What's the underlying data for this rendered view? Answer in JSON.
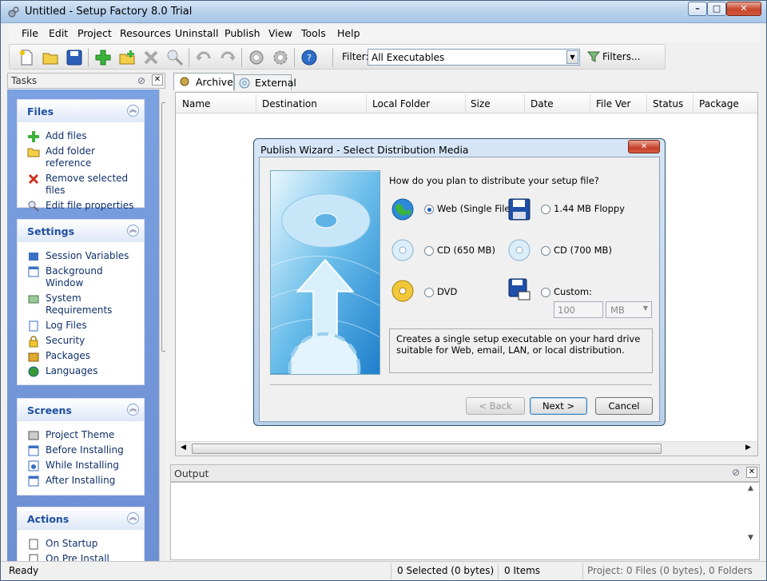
{
  "window": {
    "title": "Untitled - Setup Factory 8.0 Trial",
    "min": "–",
    "max": "□",
    "close": "✕"
  },
  "menu": [
    "File",
    "Edit",
    "Project",
    "Resources",
    "Uninstall",
    "Publish",
    "View",
    "Tools",
    "Help"
  ],
  "toolbar": {
    "filter_label": "Filter:",
    "filter_value": "All Executables",
    "filters_button": "Filters..."
  },
  "tasks": {
    "title": "Tasks",
    "groups": [
      {
        "title": "Files",
        "items": [
          "Add files",
          "Add folder reference",
          "Remove selected files",
          "Edit file properties"
        ]
      },
      {
        "title": "Settings",
        "items": [
          "Session Variables",
          "Background Window",
          "System Requirements",
          "Log Files",
          "Security",
          "Packages",
          "Languages"
        ]
      },
      {
        "title": "Screens",
        "items": [
          "Project Theme",
          "Before Installing",
          "While Installing",
          "After Installing"
        ]
      },
      {
        "title": "Actions",
        "items": [
          "On Startup",
          "On Pre Install"
        ]
      }
    ]
  },
  "tabs": [
    "Archive",
    "External"
  ],
  "columns": [
    "Name",
    "Destination",
    "Local Folder",
    "Size",
    "Date",
    "File Ver",
    "Status",
    "Package"
  ],
  "output": {
    "title": "Output"
  },
  "status": {
    "ready": "Ready",
    "selected": "0 Selected (0 bytes)",
    "items": "0 Items",
    "project": "Project: 0 Files (0 bytes), 0 Folders"
  },
  "dialog": {
    "title": "Publish Wizard - Select Distribution Media",
    "question": "How do you plan to distribute your setup file?",
    "options": {
      "web": "Web (Single File)",
      "floppy": "1.44 MB Floppy",
      "cd650": "CD (650 MB)",
      "cd700": "CD (700 MB)",
      "dvd": "DVD",
      "custom": "Custom:"
    },
    "custom_size": "100",
    "custom_unit": "MB",
    "description": "Creates a single setup executable on your hard drive suitable for Web, email, LAN, or local distribution.",
    "back": "< Back",
    "next": "Next >",
    "cancel": "Cancel",
    "close": "✕"
  }
}
